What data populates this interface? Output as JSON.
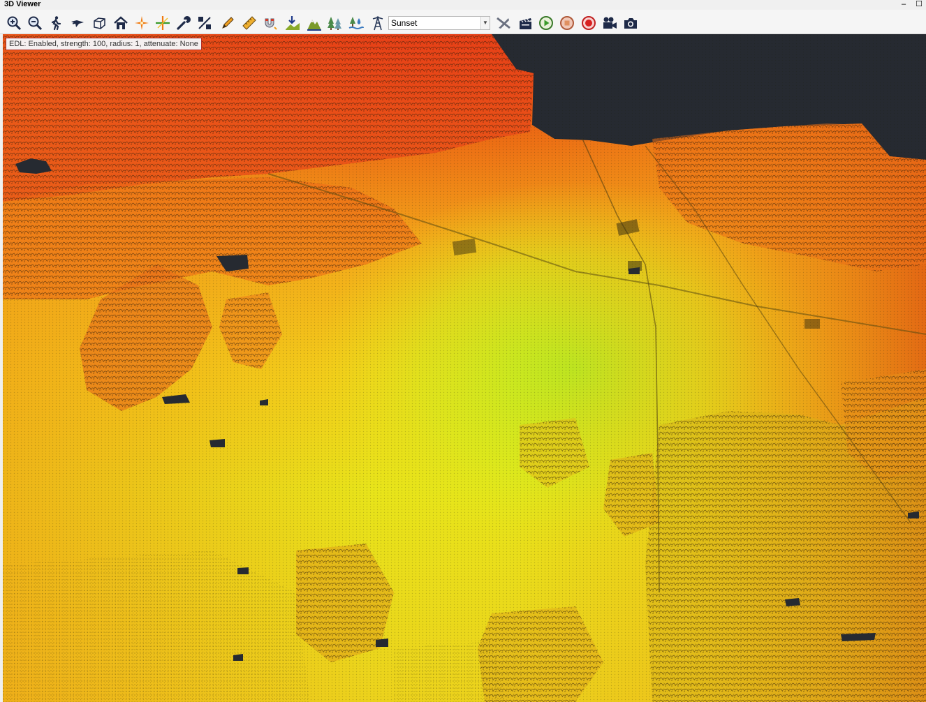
{
  "window": {
    "title": "3D Viewer",
    "minimize_glyph": "–",
    "maximize_glyph": "☐"
  },
  "toolbar": {
    "tools": [
      {
        "name": "zoom-in-icon"
      },
      {
        "name": "zoom-out-icon"
      },
      {
        "name": "walk-icon"
      },
      {
        "name": "fly-icon"
      },
      {
        "name": "bounding-box-icon"
      },
      {
        "name": "home-icon"
      },
      {
        "name": "pivot-point-icon"
      },
      {
        "name": "center-point-icon"
      },
      {
        "name": "settings-wrench-icon"
      },
      {
        "name": "percent-icon"
      },
      {
        "name": "pencil-icon"
      },
      {
        "name": "ruler-icon"
      },
      {
        "name": "snap-magnet-icon"
      },
      {
        "name": "ground-download-icon"
      },
      {
        "name": "terrain-icon"
      },
      {
        "name": "trees-icon"
      },
      {
        "name": "water-icon"
      },
      {
        "name": "tower-icon"
      }
    ],
    "color_mode": "Sunset",
    "playback_tools": [
      {
        "name": "airplane-icon"
      },
      {
        "name": "clapperboard-icon"
      },
      {
        "name": "play-icon"
      },
      {
        "name": "stop-icon"
      },
      {
        "name": "record-icon"
      },
      {
        "name": "video-camera-icon"
      },
      {
        "name": "camera-icon"
      }
    ]
  },
  "viewport": {
    "edl_status": "EDL: Enabled, strength: 100, radius: 1, attenuate: None",
    "colors": {
      "background": "#262a31",
      "high": "#e32a10",
      "mid_high": "#f0821a",
      "mid": "#f3c21a",
      "low": "#e6ec12",
      "lowest": "#b8ee22"
    }
  }
}
